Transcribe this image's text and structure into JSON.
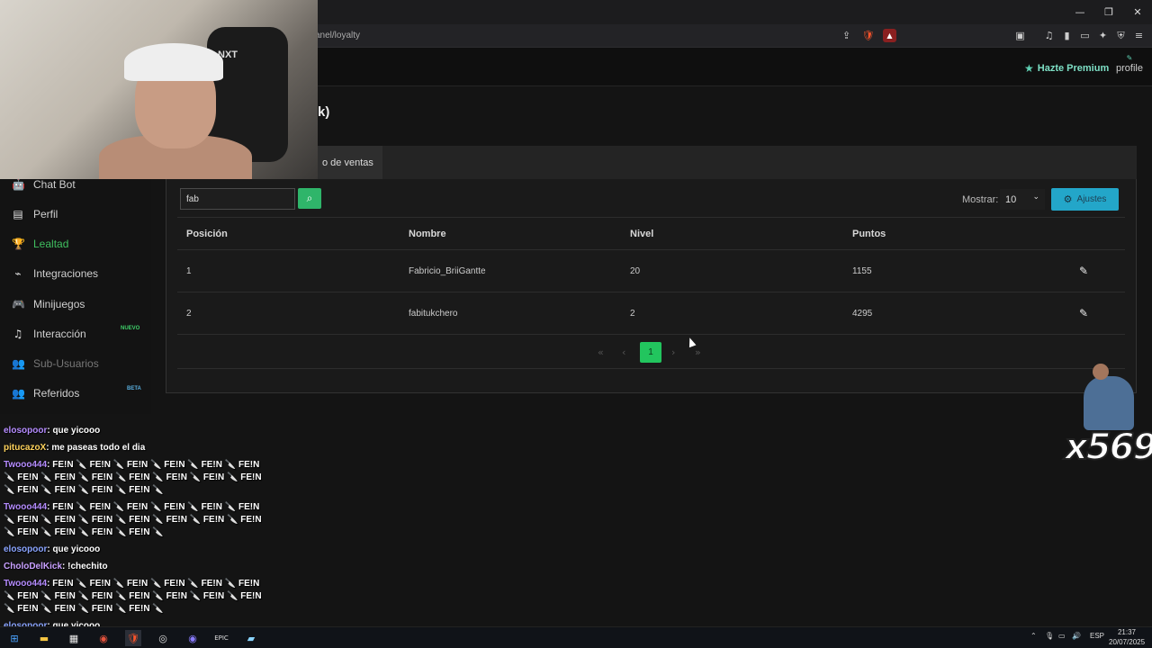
{
  "browser": {
    "url": "anel/loyalty",
    "win_min": "—",
    "win_max": "❐",
    "win_close": "✕"
  },
  "header": {
    "premium_label": "Hazte Premium",
    "profile_label": "profile",
    "page_title": "k)"
  },
  "sidebar": {
    "items": [
      {
        "label": "Chat Bot",
        "icon": "robot-icon",
        "glyph": "🤖"
      },
      {
        "label": "Perfil",
        "icon": "id-card-icon",
        "glyph": "▤"
      },
      {
        "label": "Lealtad",
        "icon": "trophy-icon",
        "glyph": "🏆"
      },
      {
        "label": "Integraciones",
        "icon": "plug-icon",
        "glyph": "⌁"
      },
      {
        "label": "Minijuegos",
        "icon": "gamepad-icon",
        "glyph": "🎮"
      },
      {
        "label": "Interacción",
        "icon": "music-icon",
        "glyph": "♫"
      },
      {
        "label": "Sub-Usuarios",
        "icon": "users-icon",
        "glyph": "👥"
      },
      {
        "label": "Referidos",
        "icon": "user-group-icon",
        "glyph": "👥"
      }
    ],
    "badge_new": "NUEVO",
    "badge_beta": "BETA"
  },
  "tabs": {
    "ventas": "o de ventas"
  },
  "search": {
    "value": "fab",
    "button_icon": "search-icon"
  },
  "mostrar": {
    "label": "Mostrar:",
    "value": "10"
  },
  "ajustes": {
    "label": "Ajustes",
    "icon": "gears-icon"
  },
  "table": {
    "headers": [
      "Posición",
      "Nombre",
      "Nivel",
      "Puntos"
    ],
    "rows": [
      {
        "pos": "1",
        "name": "Fabricio_BriiGantte",
        "level": "20",
        "points": "1155"
      },
      {
        "pos": "2",
        "name": "fabitukchero",
        "level": "2",
        "points": "4295"
      }
    ]
  },
  "pagination": {
    "first": "«",
    "prev": "‹",
    "current": "1",
    "next": "›",
    "last": "»"
  },
  "chat": [
    {
      "user": "elosopoor",
      "msg": "que yicooo"
    },
    {
      "user": "pitucazoX",
      "msg": "me paseas todo el dia"
    },
    {
      "user": "Twooo444",
      "msg": "FE!N 🔪 FE!N 🔪 FE!N 🔪 FE!N 🔪 FE!N 🔪 FE!N"
    },
    {
      "user": "",
      "msg": "🔪 FE!N 🔪 FE!N 🔪 FE!N 🔪 FE!N 🔪 FE!N 🔪 FE!N 🔪 FE!N"
    },
    {
      "user": "",
      "msg": "🔪 FE!N 🔪 FE!N 🔪 FE!N 🔪 FE!N 🔪"
    },
    {
      "user": "Twooo444",
      "msg": "FE!N 🔪 FE!N 🔪 FE!N 🔪 FE!N 🔪 FE!N 🔪 FE!N"
    },
    {
      "user": "",
      "msg": "🔪 FE!N 🔪 FE!N 🔪 FE!N 🔪 FE!N 🔪 FE!N 🔪 FE!N 🔪 FE!N"
    },
    {
      "user": "",
      "msg": "🔪 FE!N 🔪 FE!N 🔪 FE!N 🔪 FE!N 🔪"
    },
    {
      "user": "elosopoor",
      "msg": "que yicooo"
    },
    {
      "user": "CholoDelKick",
      "msg": "!chechito"
    },
    {
      "user": "Twooo444",
      "msg": "FE!N 🔪 FE!N 🔪 FE!N 🔪 FE!N 🔪 FE!N 🔪 FE!N"
    },
    {
      "user": "",
      "msg": "🔪 FE!N 🔪 FE!N 🔪 FE!N 🔪 FE!N 🔪 FE!N 🔪 FE!N 🔪 FE!N"
    },
    {
      "user": "",
      "msg": "🔪 FE!N 🔪 FE!N 🔪 FE!N 🔪 FE!N 🔪"
    },
    {
      "user": "elosopoor",
      "msg": "que yicooo"
    }
  ],
  "overlay": {
    "count": "x569"
  },
  "webcam": {
    "logo": "NXT"
  },
  "taskbar": {
    "lang": "ESP",
    "time": "21:37",
    "date": "20/07/2025"
  }
}
